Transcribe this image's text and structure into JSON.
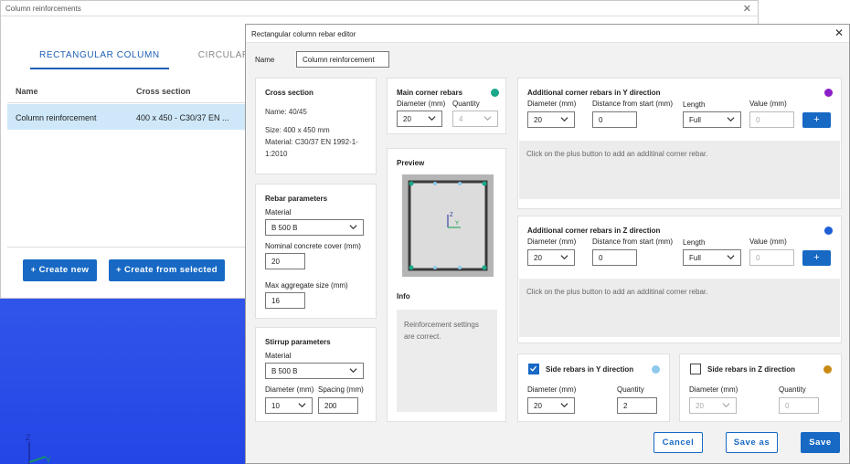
{
  "bg_window": {
    "title": "Column reinforcements",
    "tabs": [
      {
        "label": "RECTANGULAR COLUMN"
      },
      {
        "label": "CIRCULAR COLUMN"
      }
    ],
    "columns": [
      "Name",
      "Cross section"
    ],
    "rows": [
      {
        "name": "Column reinforcement",
        "cross_section": "400 x 450 - C30/37 EN ..."
      }
    ],
    "create_new": "+ Create new",
    "create_from_selected": "+ Create from selected"
  },
  "axes": {
    "z": "Z",
    "y": "Y"
  },
  "dialog": {
    "title": "Rectangular column rebar editor",
    "name_label": "Name",
    "name_value": "Column reinforcement",
    "cross_section": {
      "header": "Cross section",
      "name_line": "Name: 40/45",
      "size_line": "Size: 400 x 450 mm",
      "material_line": "Material: C30/37 EN 1992-1-1:2010"
    },
    "rebar_params": {
      "header": "Rebar parameters",
      "material_label": "Material",
      "material_value": "B 500 B",
      "cover_label": "Nominal concrete cover (mm)",
      "cover_value": "20",
      "agg_label": "Max aggregate size (mm)",
      "agg_value": "16"
    },
    "stirrup_params": {
      "header": "Stirrup parameters",
      "material_label": "Material",
      "material_value": "B 500 B",
      "diameter_label": "Diameter (mm)",
      "diameter_value": "10",
      "spacing_label": "Spacing (mm)",
      "spacing_value": "200"
    },
    "main_corner": {
      "header": "Main corner rebars",
      "diameter_label": "Diameter (mm)",
      "diameter_value": "20",
      "quantity_label": "Quantity",
      "quantity_value": "4",
      "color": "#19a98a"
    },
    "preview": {
      "header": "Preview",
      "z": "Z",
      "y": "Y"
    },
    "info": {
      "header": "Info",
      "message": "Reinforcement settings are correct."
    },
    "add_y": {
      "header": "Additional corner rebars in Y direction",
      "diameter_label": "Diameter (mm)",
      "diameter_value": "20",
      "distance_label": "Distance from start (mm)",
      "distance_value": "0",
      "length_label": "Length",
      "length_value": "Full",
      "value_label": "Value (mm)",
      "value_placeholder": "0",
      "plus": "+",
      "note": "Click on the plus button to add an additinal corner rebar.",
      "color": "#8b1fc7"
    },
    "add_z": {
      "header": "Additional corner rebars in Z direction",
      "diameter_label": "Diameter (mm)",
      "diameter_value": "20",
      "distance_label": "Distance from start (mm)",
      "distance_value": "0",
      "length_label": "Length",
      "length_value": "Full",
      "value_label": "Value (mm)",
      "value_placeholder": "0",
      "plus": "+",
      "note": "Click on the plus button to add an additinal corner rebar.",
      "color": "#1f5fd6"
    },
    "side_y": {
      "header": "Side rebars in Y direction",
      "checked": true,
      "diameter_label": "Diameter (mm)",
      "diameter_value": "20",
      "quantity_label": "Quantity",
      "quantity_value": "2",
      "color": "#8ec9ec"
    },
    "side_z": {
      "header": "Side rebars in Z direction",
      "checked": false,
      "diameter_label": "Diameter (mm)",
      "diameter_value": "20",
      "quantity_label": "Quantity",
      "quantity_value": "0",
      "color": "#c98a13"
    },
    "buttons": {
      "cancel": "Cancel",
      "save_as": "Save as",
      "save": "Save"
    }
  }
}
